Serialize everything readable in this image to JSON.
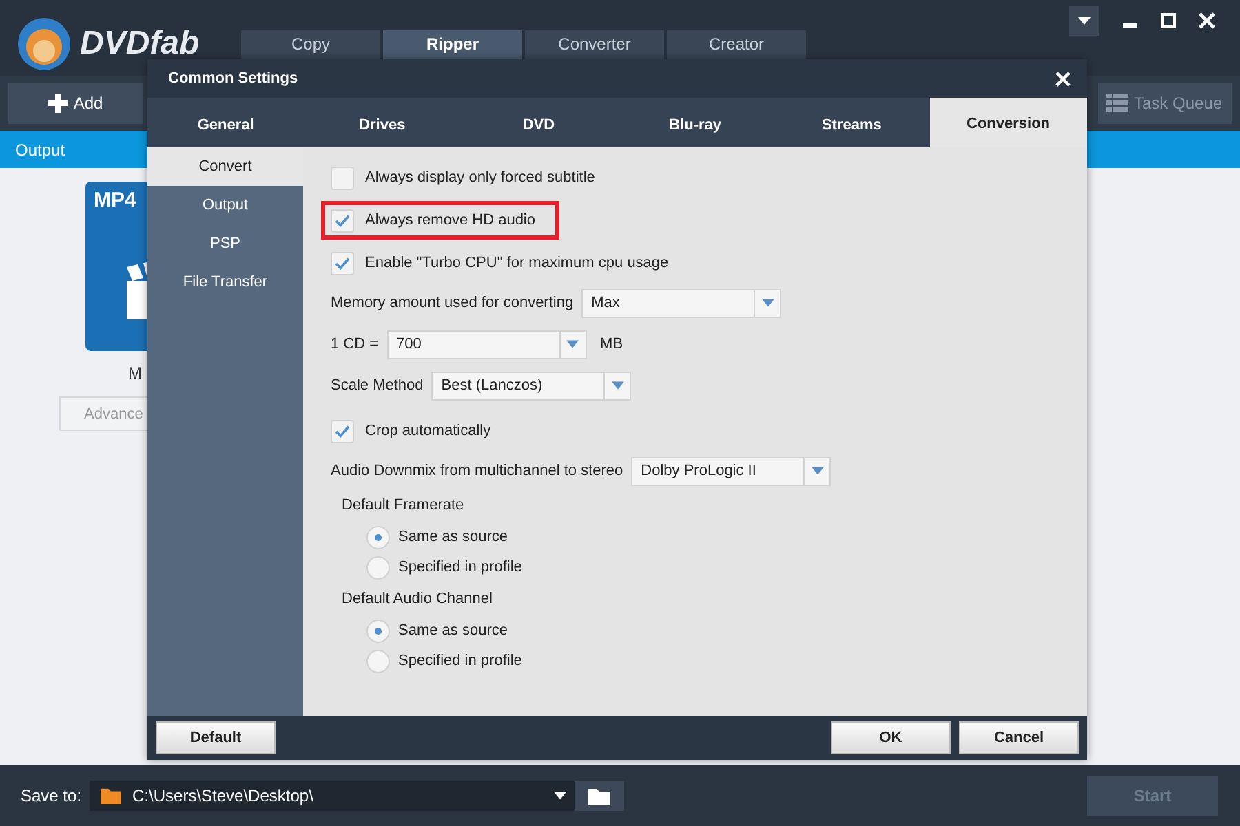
{
  "app": {
    "logo": "DVDfab",
    "tabs": [
      {
        "label": "Copy",
        "selected": false
      },
      {
        "label": "Ripper",
        "selected": true
      },
      {
        "label": "Converter",
        "selected": false
      },
      {
        "label": "Creator",
        "selected": false
      }
    ],
    "add_button": "Add",
    "task_queue": "Task Queue",
    "output_bar": "Output",
    "profile": {
      "badge": "MP4",
      "name": "M",
      "advanced": "Advance"
    },
    "save_to": {
      "label": "Save to:",
      "path": "C:\\Users\\Steve\\Desktop\\"
    },
    "start": {
      "label": "Start",
      "disabled": true
    }
  },
  "dialog": {
    "title": "Common Settings",
    "tabs": [
      {
        "label": "General",
        "selected": false
      },
      {
        "label": "Drives",
        "selected": false
      },
      {
        "label": "DVD",
        "selected": false
      },
      {
        "label": "Blu-ray",
        "selected": false
      },
      {
        "label": "Streams",
        "selected": false
      },
      {
        "label": "Conversion",
        "selected": true
      }
    ],
    "nav": [
      {
        "label": "Convert",
        "selected": true
      },
      {
        "label": "Output",
        "selected": false
      },
      {
        "label": "PSP",
        "selected": false
      },
      {
        "label": "File Transfer",
        "selected": false
      }
    ],
    "settings": [
      {
        "kind": "checkbox",
        "label": "Always display only forced subtitle",
        "checked": false,
        "highlighted": false
      },
      {
        "kind": "checkbox",
        "label": "Always remove HD audio",
        "checked": true,
        "highlighted": true
      },
      {
        "kind": "checkbox",
        "label": "Enable \"Turbo CPU\" for maximum cpu usage",
        "checked": true,
        "highlighted": false
      },
      {
        "kind": "select",
        "label": "Memory amount used for converting",
        "value": "Max"
      },
      {
        "kind": "select",
        "label": "1 CD =",
        "value": "700",
        "unit": "MB"
      },
      {
        "kind": "select",
        "label": "Scale Method",
        "value": "Best (Lanczos)"
      },
      {
        "kind": "checkbox",
        "label": "Crop automatically",
        "checked": true,
        "highlighted": false
      },
      {
        "kind": "select",
        "label": "Audio Downmix from multichannel to stereo",
        "value": "Dolby ProLogic II"
      },
      {
        "kind": "radio_group",
        "label": "Default Framerate",
        "options": [
          {
            "label": "Same as source",
            "selected": true
          },
          {
            "label": "Specified in profile",
            "selected": false
          }
        ]
      },
      {
        "kind": "radio_group",
        "label": "Default Audio Channel",
        "options": [
          {
            "label": "Same as source",
            "selected": true
          },
          {
            "label": "Specified in profile",
            "selected": false
          }
        ]
      }
    ],
    "default_button": "Default",
    "ok_button": "OK",
    "cancel_button": "Cancel"
  }
}
